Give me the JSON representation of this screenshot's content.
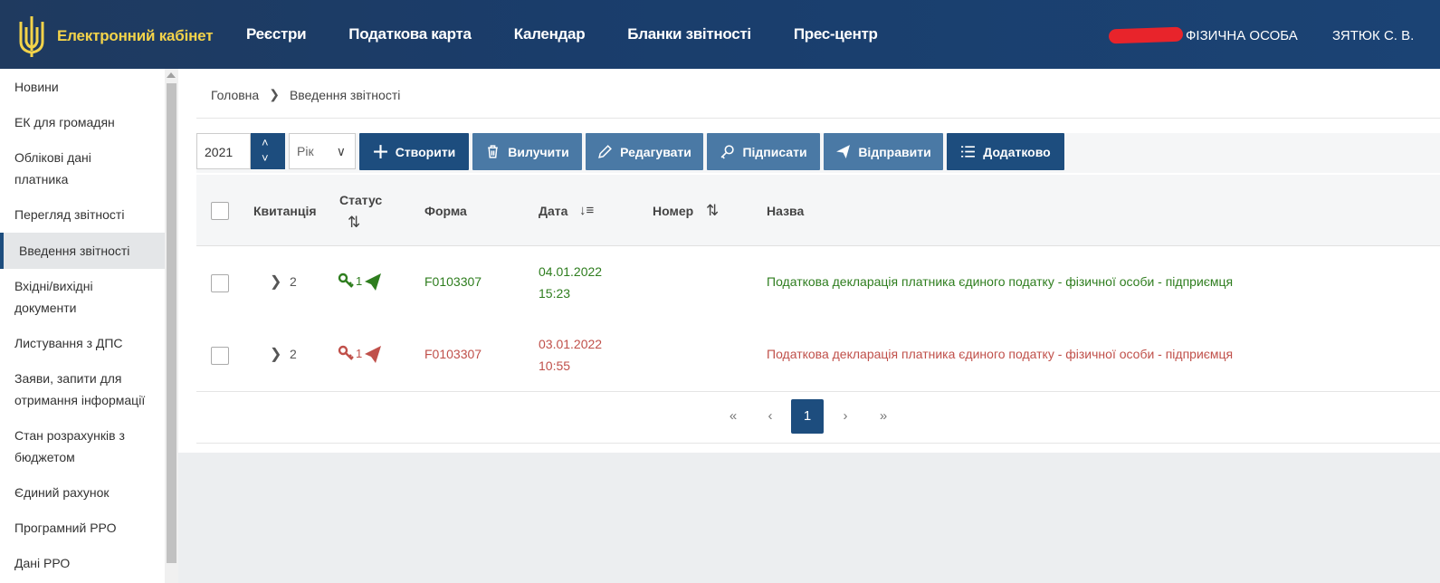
{
  "header": {
    "brand": "Електронний кабінет",
    "nav": [
      "Реєстри",
      "Податкова карта",
      "Календар",
      "Бланки звітності",
      "Прес-центр"
    ],
    "user_role": "ФІЗИЧНА ОСОБА",
    "user_name": "ЗЯТЮК С. В."
  },
  "sidebar": {
    "items": [
      {
        "label": "Новини"
      },
      {
        "label": "ЕК для громадян"
      },
      {
        "label": "Облікові дані платника"
      },
      {
        "label": "Перегляд звітності"
      },
      {
        "label": "Введення звітності",
        "active": true
      },
      {
        "label": "Вхідні/вихідні документи"
      },
      {
        "label": "Листування з ДПС"
      },
      {
        "label": "Заяви, запити для отримання інформації"
      },
      {
        "label": "Стан розрахунків з бюджетом"
      },
      {
        "label": "Єдиний рахунок"
      },
      {
        "label": "Програмний РРО"
      },
      {
        "label": "Дані РРО"
      }
    ]
  },
  "breadcrumb": {
    "home": "Головна",
    "current": "Введення звітності"
  },
  "toolbar": {
    "year": "2021",
    "period": "Рік",
    "buttons": {
      "create": "Створити",
      "delete": "Вилучити",
      "edit": "Редагувати",
      "sign": "Підписати",
      "send": "Відправити",
      "more": "Додатково"
    }
  },
  "table": {
    "headers": {
      "receipt": "Квитанція",
      "status": "Статус",
      "form": "Форма",
      "date": "Дата",
      "number": "Номер",
      "name": "Назва"
    },
    "rows": [
      {
        "receipt_count": "2",
        "status_count": "1",
        "status_color": "#2e7d1e",
        "form": "F0103307",
        "date": "04.01.2022",
        "time": "15:23",
        "number": "",
        "name": "Податкова декларація платника єдиного податку - фізичної особи - підприємця"
      },
      {
        "receipt_count": "2",
        "status_count": "1",
        "status_color": "#c0504a",
        "form": "F0103307",
        "date": "03.01.2022",
        "time": "10:55",
        "number": "",
        "name": "Податкова декларація платника єдиного податку - фізичної особи - підприємця"
      }
    ]
  },
  "pagination": {
    "first": "«",
    "prev": "‹",
    "current": "1",
    "next": "›",
    "last": "»"
  }
}
